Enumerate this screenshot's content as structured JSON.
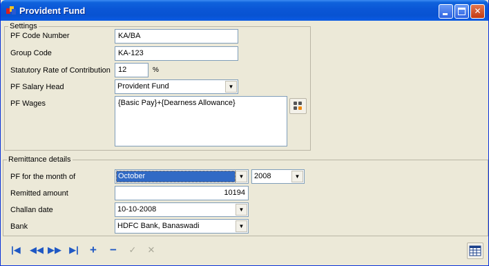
{
  "window": {
    "title": "Provident Fund"
  },
  "settings": {
    "legend": "Settings",
    "pf_code_label": "PF Code Number",
    "pf_code_value": "KA/BA",
    "group_code_label": "Group Code",
    "group_code_value": "KA-123",
    "rate_label": "Statutory Rate of Contribution",
    "rate_value": "12",
    "rate_unit": "%",
    "salary_head_label": "PF Salary Head",
    "salary_head_value": "Provident Fund",
    "wages_label": "PF Wages",
    "wages_value": "{Basic Pay}+{Dearness Allowance}"
  },
  "remittance": {
    "legend": "Remittance details",
    "month_label": "PF for the month of",
    "month_value": "October",
    "year_value": "2008",
    "amount_label": "Remitted amount",
    "amount_value": "10194",
    "challan_label": "Challan date",
    "challan_value": "10-10-2008",
    "bank_label": "Bank",
    "bank_value": "HDFC Bank, Banaswadi"
  },
  "icons": {
    "first": "first-record-icon",
    "previous": "previous-record-icon",
    "next": "next-record-icon",
    "last": "last-record-icon",
    "add": "add-icon",
    "delete": "delete-icon",
    "save": "check-icon",
    "cancel": "cancel-icon",
    "calculator": "calculator-icon",
    "grid": "grid-view-icon"
  },
  "colors": {
    "title_bar": "#0a56d6",
    "selection": "#316ac5",
    "nav_icons": "#1f58c4",
    "window_bg": "#ece9d8"
  }
}
